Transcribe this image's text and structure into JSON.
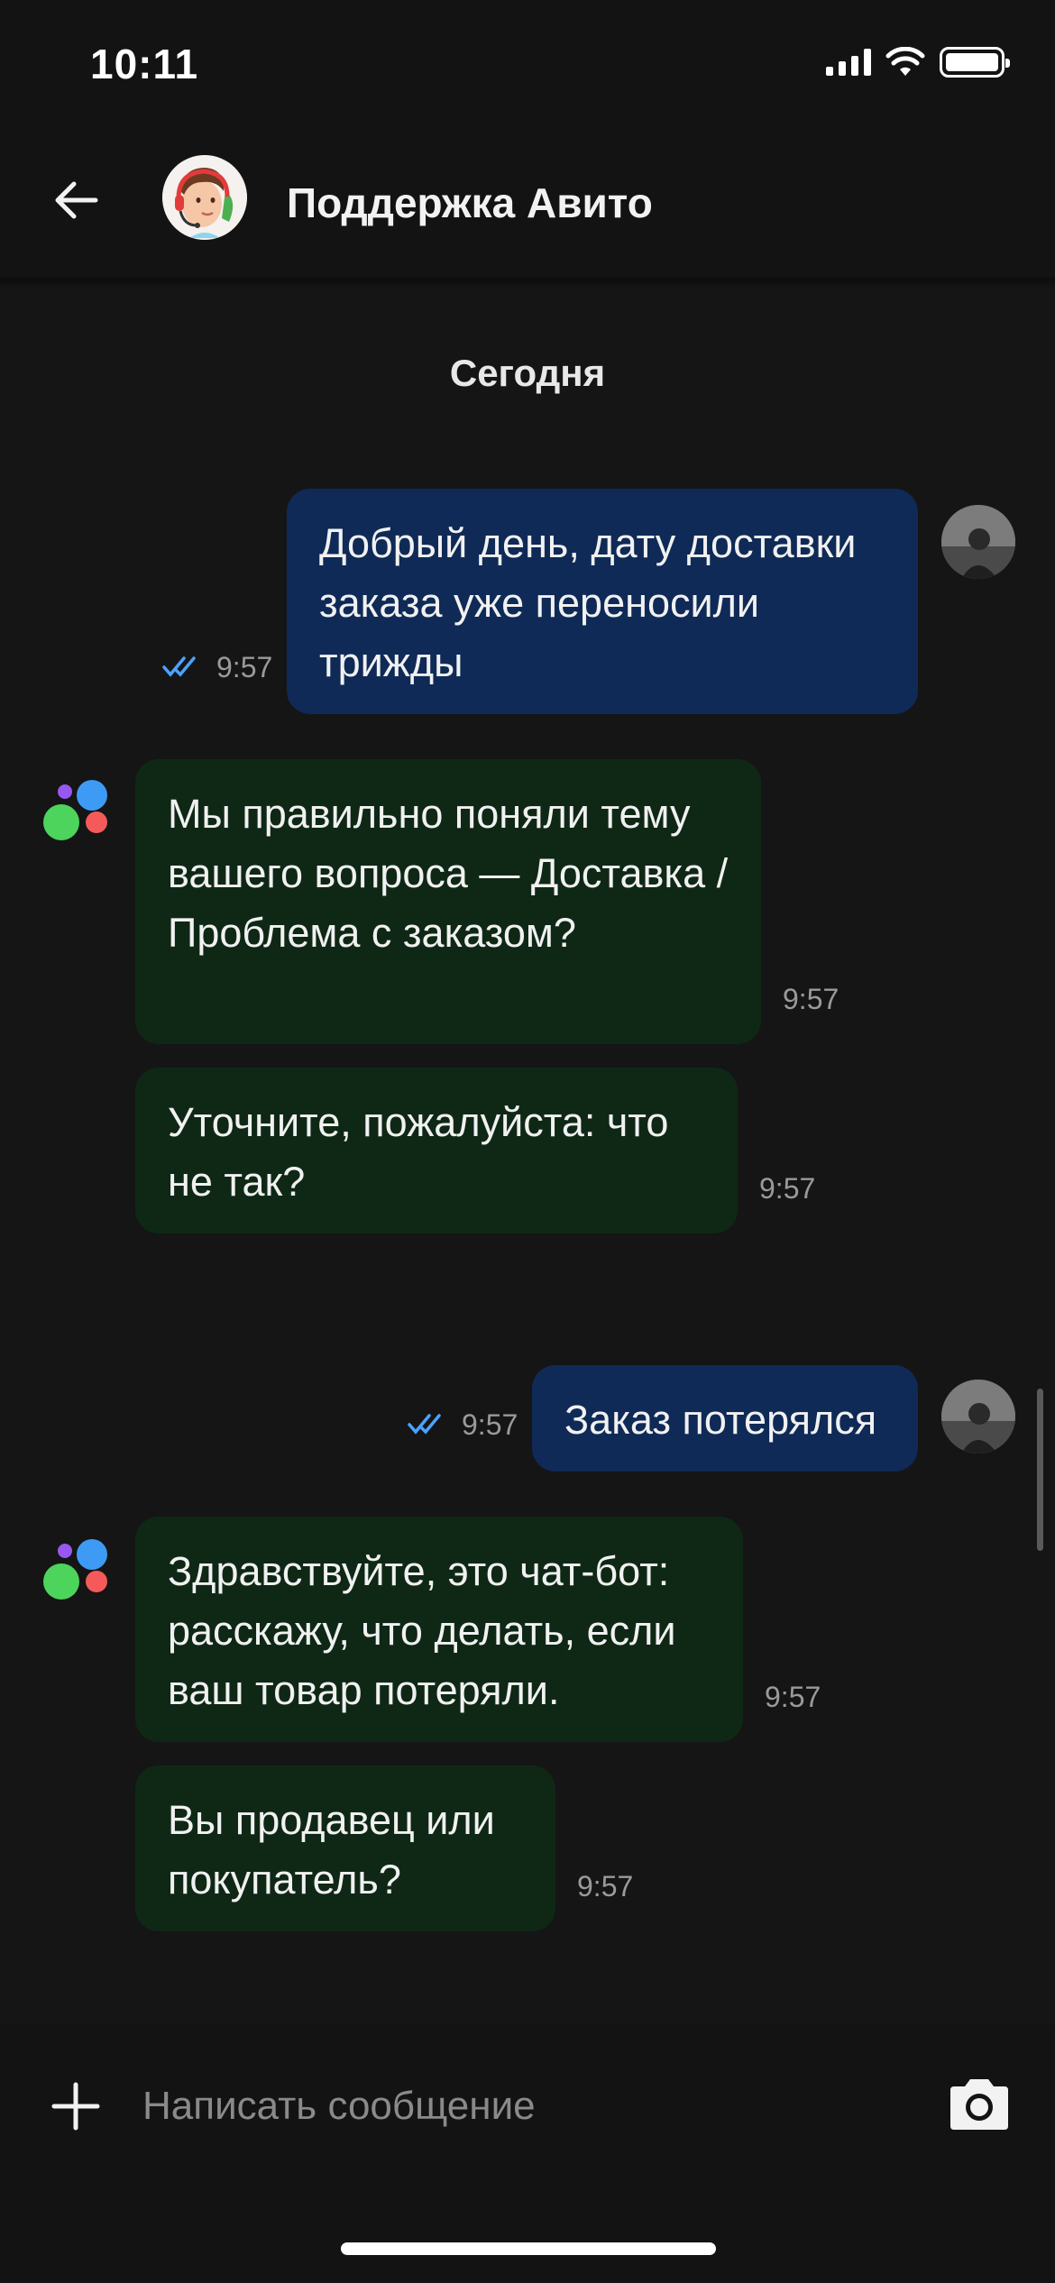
{
  "status_bar": {
    "time": "10:11"
  },
  "header": {
    "title": "Поддержка Авито",
    "back_icon": "arrow-left-icon",
    "avatar": "support-agent-avatar"
  },
  "chat": {
    "date_separator": "Сегодня",
    "messages": [
      {
        "direction": "outgoing",
        "text": "Добрый день, дату доставки заказа уже переносили трижды",
        "time": "9:57",
        "status": "read"
      },
      {
        "direction": "incoming",
        "text": "Мы правильно поняли тему вашего вопроса — Доставка / Проблема с заказом?",
        "time": "9:57"
      },
      {
        "direction": "incoming",
        "text": "Уточните, пожалуйста: что не так?",
        "time": "9:57"
      },
      {
        "direction": "outgoing",
        "text": "Заказ потерялся",
        "time": "9:57",
        "status": "read"
      },
      {
        "direction": "incoming",
        "text": "Здравствуйте, это чат-бот: расскажу, что делать, если ваш товар потеряли.",
        "time": "9:57"
      },
      {
        "direction": "incoming",
        "text": "Вы продавец или покупатель?",
        "time": "9:57"
      }
    ]
  },
  "input_bar": {
    "placeholder": "Написать сообщение",
    "value": "",
    "add_icon": "plus-icon",
    "camera_icon": "camera-icon"
  },
  "colors": {
    "background": "#131313",
    "outgoing_bubble": "#0f2a57",
    "incoming_bubble": "#0f2816",
    "read_ticks": "#4aa3ff",
    "bot_blue": "#3d9bf5",
    "bot_green": "#4cd45d",
    "bot_red": "#f55a5a",
    "bot_purple": "#9758ef"
  }
}
